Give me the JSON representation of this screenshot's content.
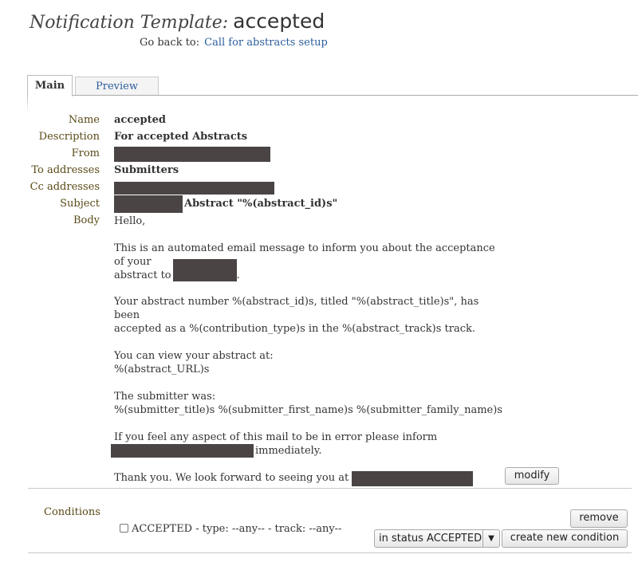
{
  "header": {
    "label": "Notification Template:",
    "name": "accepted",
    "goback_label": "Go back to:",
    "goback_link": "Call for abstracts setup"
  },
  "tabs": [
    {
      "label": "Main",
      "active": true
    },
    {
      "label": "Preview",
      "active": false
    }
  ],
  "fields": {
    "name_label": "Name",
    "name_value": "accepted",
    "description_label": "Description",
    "description_value": "For accepted Abstracts",
    "from_label": "From",
    "to_label": "To addresses",
    "to_value": "Submitters",
    "cc_label": "Cc addresses",
    "subject_label": "Subject",
    "subject_value": "Abstract \"%(abstract_id)s\"",
    "body_label": "Body"
  },
  "body": {
    "l1": "Hello,",
    "l2": "This is an automated email message to inform you about the acceptance",
    "l3": "of your",
    "l4": "abstract to",
    "l5": "Your abstract number %(abstract_id)s, titled \"%(abstract_title)s\", has",
    "l6": "been",
    "l7": "accepted as a %(contribution_type)s in the %(abstract_track)s track.",
    "l8": "You can view your abstract at:",
    "l9": "%(abstract_URL)s",
    "l10": "The submitter was:",
    "l11": "%(submitter_title)s %(submitter_first_name)s %(submitter_family_name)s",
    "l12": "If you feel any aspect of this mail to be in error please inform",
    "l13": "immediately.",
    "l14": "Thank you. We look forward to seeing you at"
  },
  "buttons": {
    "modify": "modify",
    "remove": "remove",
    "create_condition": "create new condition"
  },
  "conditions": {
    "label": "Conditions",
    "item": "ACCEPTED - type: --any-- - track: --any--",
    "checked": false,
    "select_value": "in status ACCEPTED"
  },
  "colors": {
    "link": "#2a5d9c",
    "field_label": "#5a4a17",
    "redaction": "#4a4444"
  }
}
